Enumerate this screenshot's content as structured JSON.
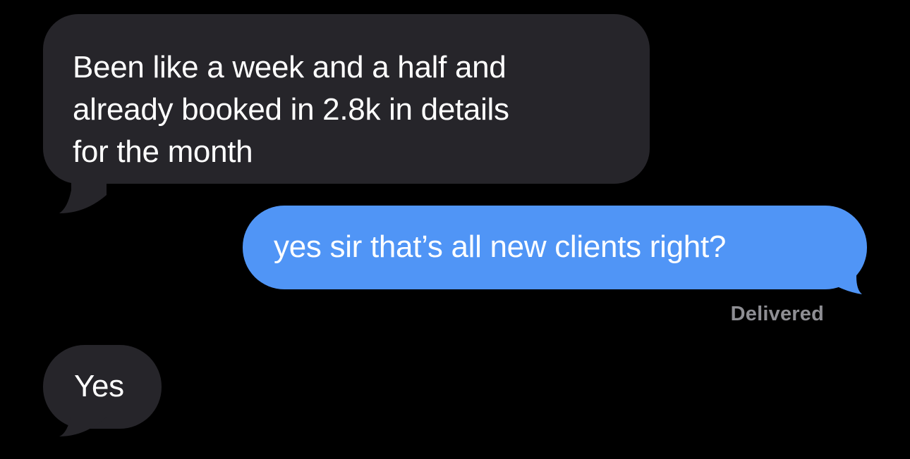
{
  "conversation": {
    "messages": [
      {
        "direction": "incoming",
        "text": "Been like a week and a half and\nalready booked in 2.8k in details\nfor the month"
      },
      {
        "direction": "outgoing",
        "text": "yes sir that’s all new clients right?",
        "status": "Delivered"
      },
      {
        "direction": "incoming",
        "text": "Yes"
      }
    ]
  },
  "colors": {
    "background": "#000000",
    "incoming_bubble": "#26252a",
    "outgoing_bubble": "#5095f6",
    "bubble_text": "#ffffff",
    "status_text": "#8e8e93"
  }
}
